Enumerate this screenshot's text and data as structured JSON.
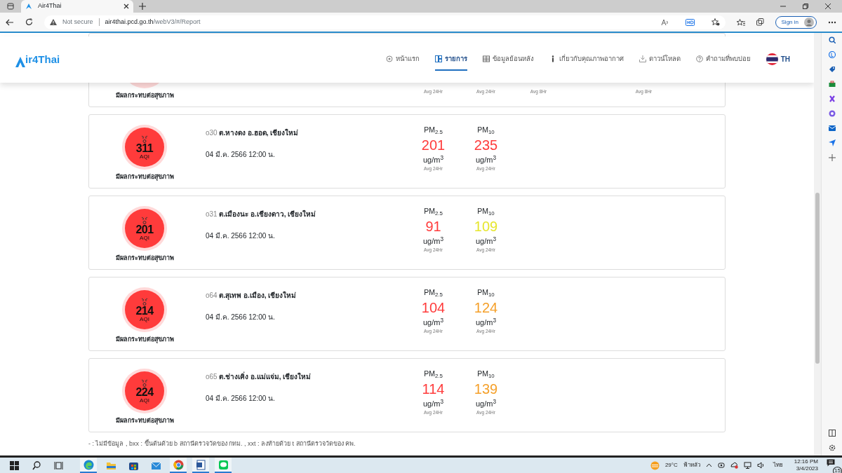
{
  "browser": {
    "tab_title": "Air4Thai",
    "security": "Not secure",
    "host": "air4thai.pcd.go.th",
    "path": "/webV3/#/Report",
    "sign_in": "Sign in"
  },
  "site": {
    "logo_text": "ir4Thai",
    "nav": [
      {
        "label": "หน้าแรก",
        "selected": false
      },
      {
        "label": "รายการ",
        "selected": true
      },
      {
        "label": "ข้อมูลย้อนหลัง",
        "selected": false
      },
      {
        "label": "เกี่ยวกับคุณภาพอากาศ",
        "selected": false
      },
      {
        "label": "ดาวน์โหลด",
        "selected": false
      },
      {
        "label": "คำถามที่พบบ่อย",
        "selected": false
      }
    ],
    "language": "TH"
  },
  "partial_card": {
    "health": "มีผลกระทบต่อสุขภาพ",
    "columns": [
      {
        "kind": "average",
        "label": "Avg 24Hr"
      },
      {
        "kind": "average",
        "label": "Avg 24Hr"
      },
      {
        "kind": "average",
        "label": "Avg 8Hr"
      },
      {
        "kind": "blank"
      },
      {
        "kind": "average",
        "label": "Avg 8Hr"
      }
    ]
  },
  "cards": [
    {
      "code": "o30",
      "name": "ต.หางดง อ.ฮอด, เชียงใหม่",
      "time": "04 มี.ค. 2566 12:00 น.",
      "aqi": "311",
      "aqi_label": "AQI",
      "health": "มีผลกระทบต่อสุขภาพ",
      "color": "#ff3b3b",
      "pollutants": [
        {
          "name": "PM$_{2.5}$",
          "value": "201",
          "color": "#ff3b3b",
          "unit": "ug/m$^{3}$",
          "avg": "Avg 24Hr"
        },
        {
          "name": "PM$_{10}$",
          "value": "235",
          "color": "#ff3b3b",
          "unit": "ug/m$^{3}$",
          "avg": "Avg 24Hr"
        }
      ]
    },
    {
      "code": "o31",
      "name": "ต.เมืองนะ อ.เชียงดาว, เชียงใหม่",
      "time": "04 มี.ค. 2566 12:00 น.",
      "aqi": "201",
      "aqi_label": "AQI",
      "health": "มีผลกระทบต่อสุขภาพ",
      "color": "#ff3b3b",
      "pollutants": [
        {
          "name": "PM$_{2.5}$",
          "value": "91",
          "color": "#ff3b3b",
          "unit": "ug/m$^{3}$",
          "avg": "Avg 24Hr"
        },
        {
          "name": "PM$_{10}$",
          "value": "109",
          "color": "#e6e62e",
          "unit": "ug/m$^{3}$",
          "avg": "Avg 24Hr"
        }
      ]
    },
    {
      "code": "o64",
      "name": "ต.สุเทพ อ.เมือง, เชียงใหม่",
      "time": "04 มี.ค. 2566 12:00 น.",
      "aqi": "214",
      "aqi_label": "AQI",
      "health": "มีผลกระทบต่อสุขภาพ",
      "color": "#ff3b3b",
      "pollutants": [
        {
          "name": "PM$_{2.5}$",
          "value": "104",
          "color": "#ff3b3b",
          "unit": "ug/m$^{3}$",
          "avg": "Avg 24Hr"
        },
        {
          "name": "PM$_{10}$",
          "value": "124",
          "color": "#f5a02a",
          "unit": "ug/m$^{3}$",
          "avg": "Avg 24Hr"
        }
      ]
    },
    {
      "code": "o65",
      "name": "ต.ช่างเคิ่ง อ.แม่แจ่ม, เชียงใหม่",
      "time": "04 มี.ค. 2566 12:00 น.",
      "aqi": "224",
      "aqi_label": "AQI",
      "health": "มีผลกระทบต่อสุขภาพ",
      "color": "#ff3b3b",
      "pollutants": [
        {
          "name": "PM$_{2.5}$",
          "value": "114",
          "color": "#ff3b3b",
          "unit": "ug/m$^{3}$",
          "avg": "Avg 24Hr"
        },
        {
          "name": "PM$_{10}$",
          "value": "139",
          "color": "#f5a02a",
          "unit": "ug/m$^{3}$",
          "avg": "Avg 24Hr"
        }
      ]
    }
  ],
  "footnote": "- : ไม่มีข้อมูล , bxx : ขึ้นต้นด้วย b สถานีตรวจวัดของ กทม. , xxt : ลงท้ายด้วย t สถานีตรวจวัดของ คพ.",
  "taskbar": {
    "temperature": "29°C",
    "weather": "ฟ้าหลัว",
    "language": "ไทย",
    "time": "12:16 PM",
    "date": "3/4/2023",
    "notifications": "15"
  }
}
